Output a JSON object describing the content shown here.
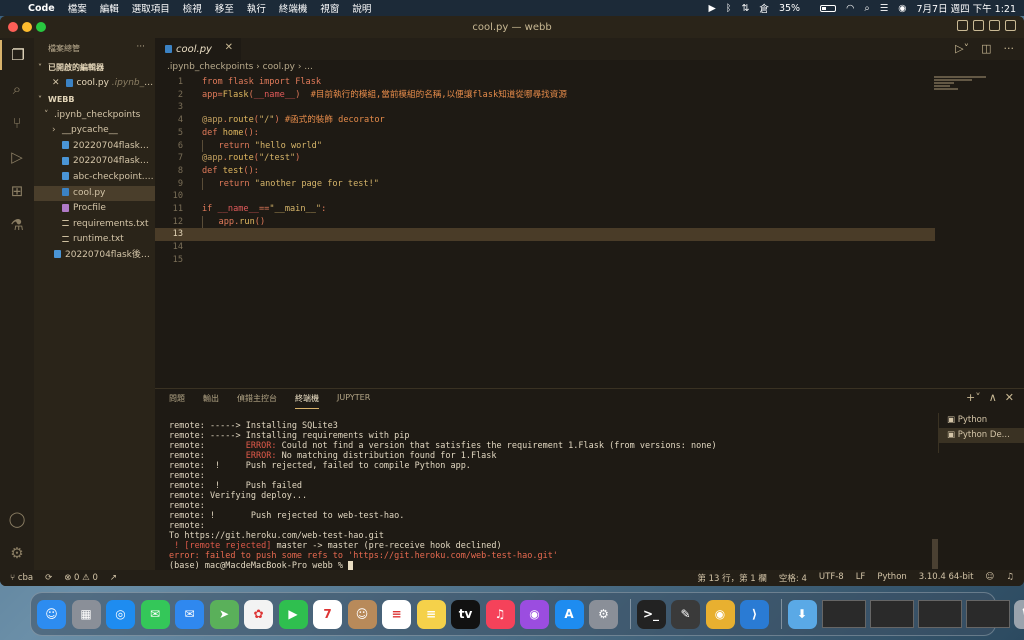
{
  "menubar": {
    "app": "Code",
    "items": [
      "檔案",
      "編輯",
      "選取項目",
      "檢視",
      "移至",
      "執行",
      "終端機",
      "視窗",
      "說明"
    ],
    "battery": "35%",
    "clock": "7月7日 週四 下午 1:21"
  },
  "window": {
    "title": "cool.py — webb"
  },
  "sidebar": {
    "title": "檔案總管",
    "open_editors_label": "已開啟的編輯器",
    "open_editor": {
      "name": "cool.py",
      "path": ".ipynb_c..."
    },
    "root_label": "WEBB",
    "items": [
      {
        "label": ".ipynb_checkpoints",
        "indent": 1,
        "chev": "˅",
        "icon": ""
      },
      {
        "label": "__pycache__",
        "indent": 2,
        "chev": "›",
        "icon": ""
      },
      {
        "label": "20220704flask後端...",
        "indent": 2,
        "chev": "",
        "icon": "nb"
      },
      {
        "label": "20220704flask網站...",
        "indent": 2,
        "chev": "",
        "icon": "nb"
      },
      {
        "label": "abc-checkpoint.ipy...",
        "indent": 2,
        "chev": "",
        "icon": "nb"
      },
      {
        "label": "cool.py",
        "indent": 2,
        "chev": "",
        "icon": "py",
        "selected": true
      },
      {
        "label": "Procfile",
        "indent": 2,
        "chev": "",
        "icon": "proc"
      },
      {
        "label": "requirements.txt",
        "indent": 2,
        "chev": "",
        "icon": "txt"
      },
      {
        "label": "runtime.txt",
        "indent": 2,
        "chev": "",
        "icon": "txt"
      },
      {
        "label": "20220704flask後端...",
        "indent": 1,
        "chev": "",
        "icon": "nb"
      }
    ]
  },
  "editor": {
    "tab": "cool.py",
    "breadcrumb": ".ipynb_checkpoints  ›  cool.py  ›  ...",
    "current_line": 13,
    "lines": [
      "from flask import Flask",
      "app=Flask(__name__)  #目前執行的模組,當前模組的名稱,以便讓flask知道從哪尋找資源",
      "",
      "@app.route(\"/\") #函式的裝飾 decorator",
      "def home():",
      "    return \"hello world\"",
      "@app.route(\"/test\")",
      "def test():",
      "    return \"another page for test!\"",
      "",
      "if __name__==\"__main__\":",
      "    app.run()",
      "",
      "",
      ""
    ]
  },
  "panel": {
    "tabs": [
      "問題",
      "輸出",
      "偵錯主控台",
      "終端機",
      "JUPYTER"
    ],
    "active_tab": "終端機",
    "terminals": [
      "Python",
      "Python De..."
    ],
    "output": [
      "remote: -----> Installing SQLite3",
      "remote: -----> Installing requirements with pip",
      "remote:        ERROR: Could not find a version that satisfies the requirement 1.Flask (from versions: none)",
      "remote:        ERROR: No matching distribution found for 1.Flask",
      "remote:  !     Push rejected, failed to compile Python app.",
      "remote:",
      "remote:  !     Push failed",
      "remote: Verifying deploy...",
      "remote:",
      "remote: !       Push rejected to web-test-hao.",
      "remote:",
      "To https://git.heroku.com/web-test-hao.git",
      " ! [remote rejected] master -> master (pre-receive hook declined)",
      "error: failed to push some refs to 'https://git.heroku.com/web-test-hao.git'",
      "(base) mac@MacdeMacBook-Pro webb % "
    ]
  },
  "status": {
    "branch": "cba",
    "problems": "⊗ 0 ⚠ 0",
    "position": "第 13 行，第 1 欄",
    "spaces": "空格: 4",
    "encoding": "UTF-8",
    "eol": "LF",
    "language": "Python",
    "interpreter": "3.10.4 64-bit"
  },
  "dock": {
    "apps": [
      {
        "name": "finder",
        "color": "#2d8cf0",
        "glyph": "☺"
      },
      {
        "name": "launchpad",
        "color": "#8a8f98",
        "glyph": "▦"
      },
      {
        "name": "safari",
        "color": "#1e8cf0",
        "glyph": "◎"
      },
      {
        "name": "messages",
        "color": "#34c759",
        "glyph": "✉"
      },
      {
        "name": "mail",
        "color": "#2f88ef",
        "glyph": "✉"
      },
      {
        "name": "maps",
        "color": "#5ab05a",
        "glyph": "➤"
      },
      {
        "name": "photos",
        "color": "#f3f3f3",
        "glyph": "✿"
      },
      {
        "name": "facetime",
        "color": "#2fbf4f",
        "glyph": "▶"
      },
      {
        "name": "calendar",
        "color": "#ffffff",
        "glyph": "7"
      },
      {
        "name": "contacts",
        "color": "#b88a5a",
        "glyph": "☺"
      },
      {
        "name": "reminders",
        "color": "#ffffff",
        "glyph": "≡"
      },
      {
        "name": "notes",
        "color": "#f5d14a",
        "glyph": "≡"
      },
      {
        "name": "apple-tv",
        "color": "#111111",
        "glyph": "tv"
      },
      {
        "name": "music",
        "color": "#f5425a",
        "glyph": "♫"
      },
      {
        "name": "podcasts",
        "color": "#9b4de0",
        "glyph": "◉"
      },
      {
        "name": "app-store",
        "color": "#1e8cf0",
        "glyph": "A"
      },
      {
        "name": "system-preferences",
        "color": "#8a8f98",
        "glyph": "⚙"
      },
      {
        "name": "terminal",
        "color": "#222222",
        "glyph": ">_"
      },
      {
        "name": "anaconda",
        "color": "#3a3a3a",
        "glyph": "✎"
      },
      {
        "name": "chrome",
        "color": "#e8b030",
        "glyph": "◉"
      },
      {
        "name": "vscode",
        "color": "#2a7bd4",
        "glyph": "⟩"
      }
    ]
  }
}
